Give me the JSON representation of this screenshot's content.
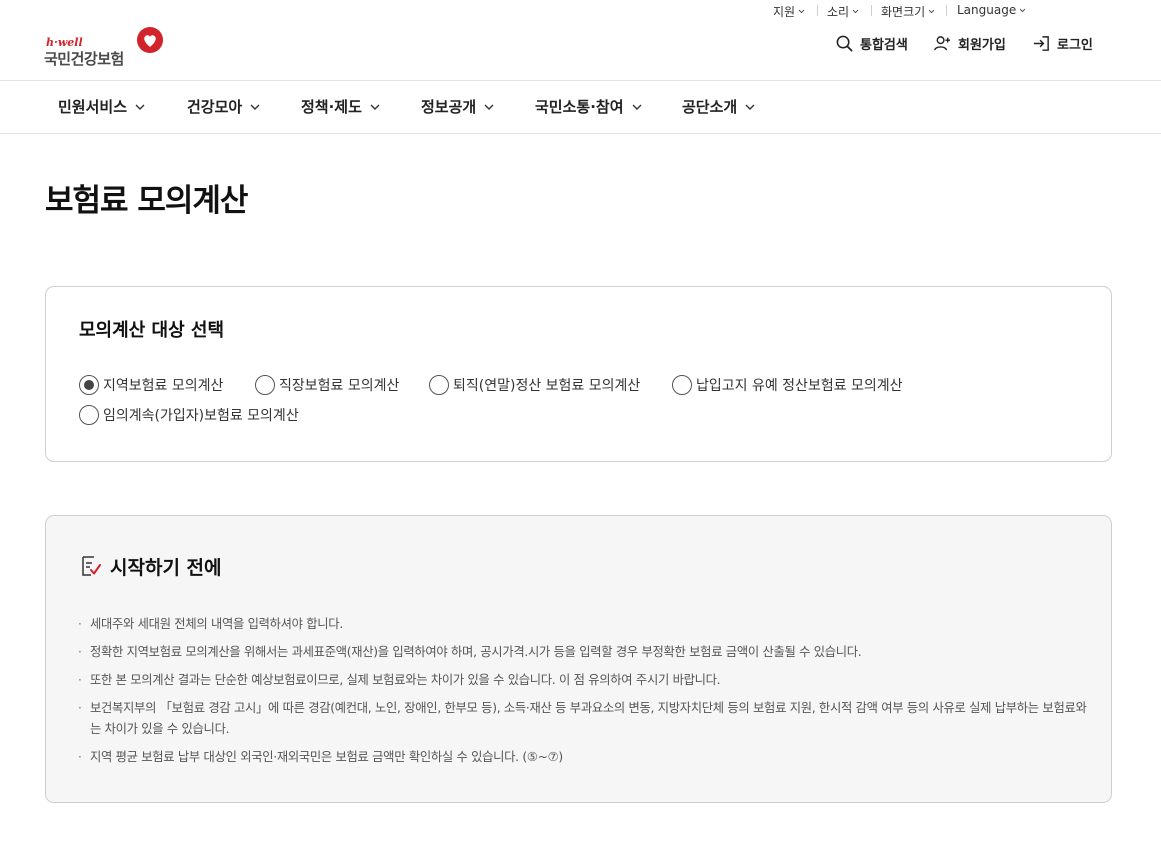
{
  "utility_bar": [
    {
      "label": "지원"
    },
    {
      "label": "소리"
    },
    {
      "label": "화면크기"
    },
    {
      "label": "Language"
    }
  ],
  "logo": {
    "sub": "h·well",
    "main": "국민건강보험",
    "brand_color": "#d2232a"
  },
  "header_links": {
    "search": "통합검색",
    "signup": "회원가입",
    "login": "로그인"
  },
  "gnb": [
    {
      "label": "민원서비스"
    },
    {
      "label": "건강모아"
    },
    {
      "label": "정책·제도"
    },
    {
      "label": "정보공개"
    },
    {
      "label": "국민소통·참여"
    },
    {
      "label": "공단소개"
    }
  ],
  "page_title": "보험료 모의계산",
  "selection": {
    "title": "모의계산 대상 선택",
    "options": [
      {
        "label": "지역보험료 모의계산",
        "checked": true
      },
      {
        "label": "직장보험료 모의계산",
        "checked": false
      },
      {
        "label": "퇴직(연말)정산 보험료 모의계산",
        "checked": false
      },
      {
        "label": "납입고지 유예 정산보험료 모의계산",
        "checked": false
      },
      {
        "label": "임의계속(가입자)보험료 모의계산",
        "checked": false
      }
    ]
  },
  "notice": {
    "title": "시작하기 전에",
    "items": [
      "세대주와 세대원 전체의 내역을 입력하셔야 합니다.",
      "정확한 지역보험료 모의계산을 위해서는 과세표준액(재산)을 입력하여야 하며, 공시가격.시가 등을 입력할 경우 부정확한 보험료 금액이 산출될 수 있습니다.",
      "또한 본 모의계산 결과는 단순한 예상보험료이므로, 실제 보험료와는 차이가 있을 수 있습니다. 이 점 유의하여 주시기 바랍니다.",
      "보건복지부의 「보험료 경감 고시」에 따른 경감(예컨대, 노인, 장애인, 한부모 등), 소득·재산 등 부과요소의 변동, 지방자치단체 등의 보험료 지원, 한시적 감액 여부 등의 사유로 실제 납부하는 보험료와는 차이가 있을 수 있습니다.",
      "지역 평균 보험료 납부 대상인 외국인·재외국민은 보험료 금액만 확인하실 수 있습니다. (⑤~⑦)"
    ]
  }
}
